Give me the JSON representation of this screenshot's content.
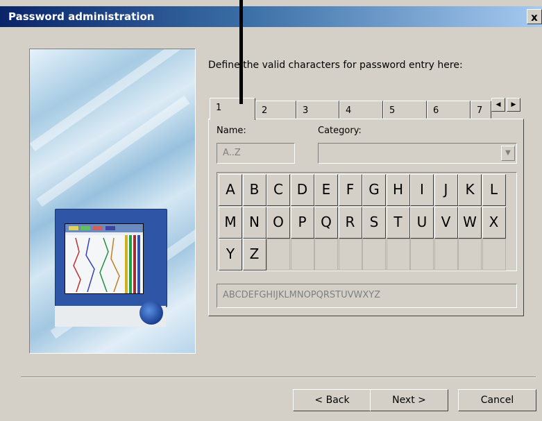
{
  "window": {
    "title": "Password administration",
    "close_label": "x"
  },
  "instruction": "Define the valid characters for password entry here:",
  "tabs": [
    "1",
    "2",
    "3",
    "4",
    "5",
    "6",
    "7"
  ],
  "active_tab": "1",
  "tab_scroll": {
    "left": "◀",
    "right": "▶"
  },
  "name": {
    "label": "Name:",
    "value": "A..Z"
  },
  "category": {
    "label": "Category:",
    "value": ""
  },
  "keys": [
    "A",
    "B",
    "C",
    "D",
    "E",
    "F",
    "G",
    "H",
    "I",
    "J",
    "K",
    "L",
    "M",
    "N",
    "O",
    "P",
    "Q",
    "R",
    "S",
    "T",
    "U",
    "V",
    "W",
    "X",
    "Y",
    "Z"
  ],
  "grid": {
    "rows": 3,
    "cols": 12
  },
  "valid_characters": "ABCDEFGHIJKLMNOPQRSTUVWXYZ",
  "buttons": {
    "back": "< Back",
    "next": "Next >",
    "cancel": "Cancel"
  }
}
